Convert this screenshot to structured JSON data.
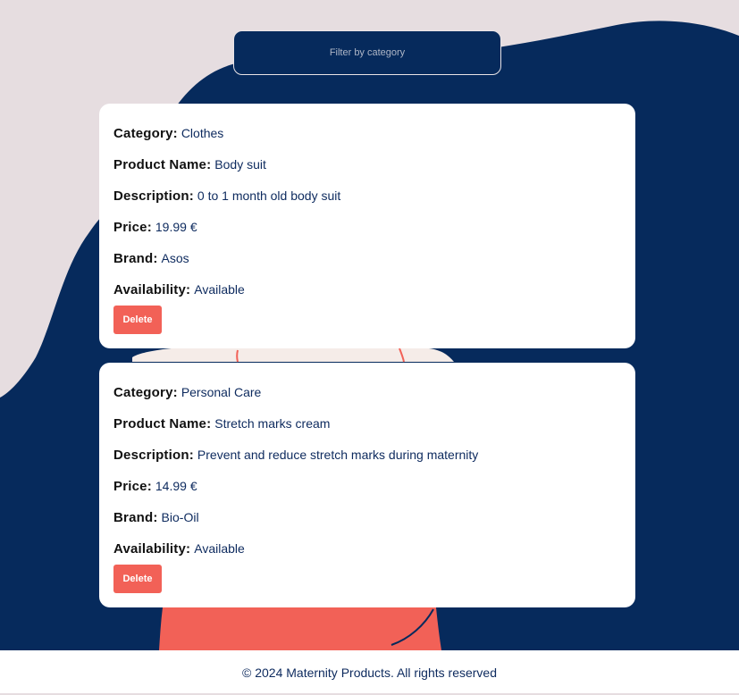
{
  "filter": {
    "label": "Filter by category"
  },
  "products": [
    {
      "category_label": "Category:",
      "category": "Clothes",
      "name_label": "Product Name:",
      "name": "Body suit",
      "description_label": "Description:",
      "description": "0 to 1 month old body suit",
      "price_label": "Price:",
      "price": "19.99 €",
      "brand_label": "Brand:",
      "brand": "Asos",
      "availability_label": "Availability:",
      "availability": "Available",
      "delete_label": "Delete"
    },
    {
      "category_label": "Category:",
      "category": "Personal Care",
      "name_label": "Product Name:",
      "name": "Stretch marks cream",
      "description_label": "Description:",
      "description": "Prevent and reduce stretch marks during maternity",
      "price_label": "Price:",
      "price": "14.99 €",
      "brand_label": "Brand:",
      "brand": "Bio-Oil",
      "availability_label": "Availability:",
      "availability": "Available",
      "delete_label": "Delete"
    }
  ],
  "footer": {
    "text": "© 2024 Maternity Products. All rights reserved"
  },
  "colors": {
    "background": "#e6dde0",
    "navy": "#062a5c",
    "coral": "#f26157",
    "card": "#ffffff"
  }
}
